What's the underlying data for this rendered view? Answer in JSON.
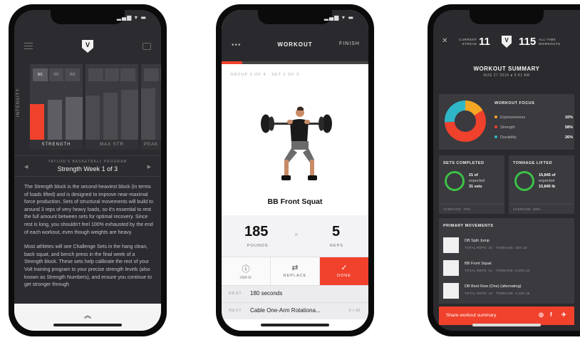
{
  "phone1": {
    "status": "▂▄▆ ▾ ▬",
    "intensity_label": "INTENSITY",
    "block1": {
      "weeks": [
        "W1",
        "W2",
        "W3"
      ],
      "label": "STRENGTH"
    },
    "block2": {
      "label": "MAX STR"
    },
    "block3": {
      "label": "PEAK"
    },
    "program": "TAYLOR'S BASKETBALL PROGRAM",
    "week_title": "Strength Week 1 of 3",
    "prev": "◀",
    "next": "▶",
    "paragraph1": "The Strength block is the second-heaviest block (in terms of loads lifted) and is designed to improve near-maximal force production. Sets of structural movements will build to around 3 reps of very heavy loads, so it's essential to rest the full amount between sets for optimal recovery. Since rest is long, you shouldn't feel 100% exhausted by the end of each workout, even though weights are heavy.",
    "paragraph2": "Most athletes will see Challenge Sets in the hang clean, back squat, and bench press in the final week of a Strength block. These sets help calibrate the rest of your Volt training program to your precise strength levels (also known as Strength Numbers), and ensure you continue to get stronger through",
    "footer_icon": "︽"
  },
  "phone2": {
    "status": "▂▄▆ ▾ ▬",
    "menu": "•••",
    "title": "WORKOUT",
    "finish": "FINISH",
    "progress_pct": 14,
    "group": "GROUP 2 OF 4 · SET 1 OF 3",
    "exercise": "BB Front Squat",
    "weight": "185",
    "weight_unit": "POUNDS",
    "times": "×",
    "reps": "5",
    "reps_unit": "REPS",
    "actions": {
      "info": {
        "icon": "ⓘ",
        "label": "INFO"
      },
      "replace": {
        "icon": "⇄",
        "label": "REPLACE"
      },
      "done": {
        "icon": "✓",
        "label": "DONE"
      }
    },
    "rest": {
      "k": "REST",
      "v": "180 seconds"
    },
    "next": {
      "k": "NEXT",
      "v": "Cable One-Arm Rotationa...",
      "x": "3 × 10"
    }
  },
  "phone3": {
    "close": "✕",
    "streak_label": "CURRENT\nSTREAK",
    "streak": "11",
    "total": "115",
    "total_label": "ALL-TIME\nWORKOUTS",
    "title": "WORKOUT SUMMARY",
    "date": "AUG 27 2019 ● 5:41 AM",
    "focus_title": "WORKOUT FOCUS",
    "focus": [
      {
        "name": "Explosiveness",
        "pct": "16%",
        "value": 16,
        "color": "#f5a623"
      },
      {
        "name": "Strength",
        "pct": "58%",
        "value": 58,
        "color": "#f0412c"
      },
      {
        "name": "Durability",
        "pct": "26%",
        "value": 26,
        "color": "#2fb7c7"
      }
    ],
    "sets": {
      "title": "SETS COMPLETED",
      "line1": "21 of",
      "line2": "expected",
      "line3": "31 sets",
      "avg": "AVERAGE: 78%"
    },
    "tonnage": {
      "title": "TONNAGE LIFTED",
      "line1": "15,845 of",
      "line2": "expected",
      "line3": "15,845 lb",
      "avg": "AVERAGE: 99%"
    },
    "pm_title": "PRIMARY MOVEMENTS",
    "movements": [
      {
        "name": "DB Split Jump",
        "meta": "TOTAL REPS: 32 · TONNAGE: 320 LB"
      },
      {
        "name": "BB Front Squat",
        "meta": "TOTAL REPS: 11 · TONNAGE: 5,500 LB"
      },
      {
        "name": "DB Bent Row (One) (alternating)",
        "meta": "TOTAL REPS: 44 · TONNAGE: 3,400 LB"
      }
    ],
    "share": "Share workout summary",
    "share_icons": [
      "◎",
      "f",
      "✈"
    ]
  }
}
